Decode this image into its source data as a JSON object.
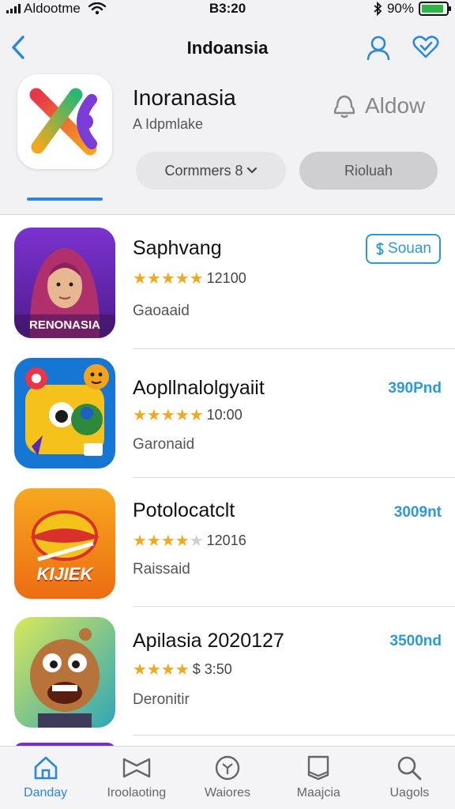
{
  "status": {
    "carrier": "Aldootme",
    "time": "B3:20",
    "battery": "90%",
    "battery_level": 0.9
  },
  "nav": {
    "title": "Indoansia"
  },
  "app": {
    "name": "Inoranasia",
    "subtitle": "A Idpmlake",
    "allow_label": "Aldow",
    "comments_label": "Cormmers 8",
    "secondary_label": "Rioluah"
  },
  "list": [
    {
      "title": "Saphvang",
      "rating": 5,
      "rating_text": "12100",
      "meta": "Gaoaaid",
      "action_label": "Souan",
      "icon_text": "RENONASIA",
      "colors": {
        "bg": "#6b2bb5",
        "accent": "#b0306e"
      }
    },
    {
      "title": "Aopllnalolgyaiit",
      "rating": 4.5,
      "rating_text": "10:00",
      "meta": "Garonaid",
      "price": "390Pnd",
      "colors": {
        "bg": "#1676d4",
        "accent": "#f4c21a"
      }
    },
    {
      "title": "Potolocatclt",
      "rating": 4.5,
      "rating_text": "12016",
      "meta": "Raissaid",
      "price": "3009nt",
      "icon_text": "KIJIEK",
      "colors": {
        "bg": "#f08a14",
        "accent": "#d8302a"
      }
    },
    {
      "title": "Apilasia 2020127",
      "rating": 4,
      "rating_text": "$ 3:50",
      "meta": "Deronitir",
      "price": "3500nd",
      "colors": {
        "bg": "#2fa5b8",
        "accent": "#b7733a"
      }
    }
  ],
  "tabs": [
    {
      "label": "Danday",
      "icon": "home-icon",
      "active": true
    },
    {
      "label": "Iroolaoting",
      "icon": "bowtie-icon",
      "active": false
    },
    {
      "label": "Waiores",
      "icon": "compass-icon",
      "active": false
    },
    {
      "label": "Maajcia",
      "icon": "book-icon",
      "active": false
    },
    {
      "label": "Uagols",
      "icon": "search-icon",
      "active": false
    }
  ],
  "colors": {
    "accent": "#2b88d9",
    "price": "#2b9ad6",
    "star": "#f2a81d",
    "battery": "#2fb34a"
  }
}
